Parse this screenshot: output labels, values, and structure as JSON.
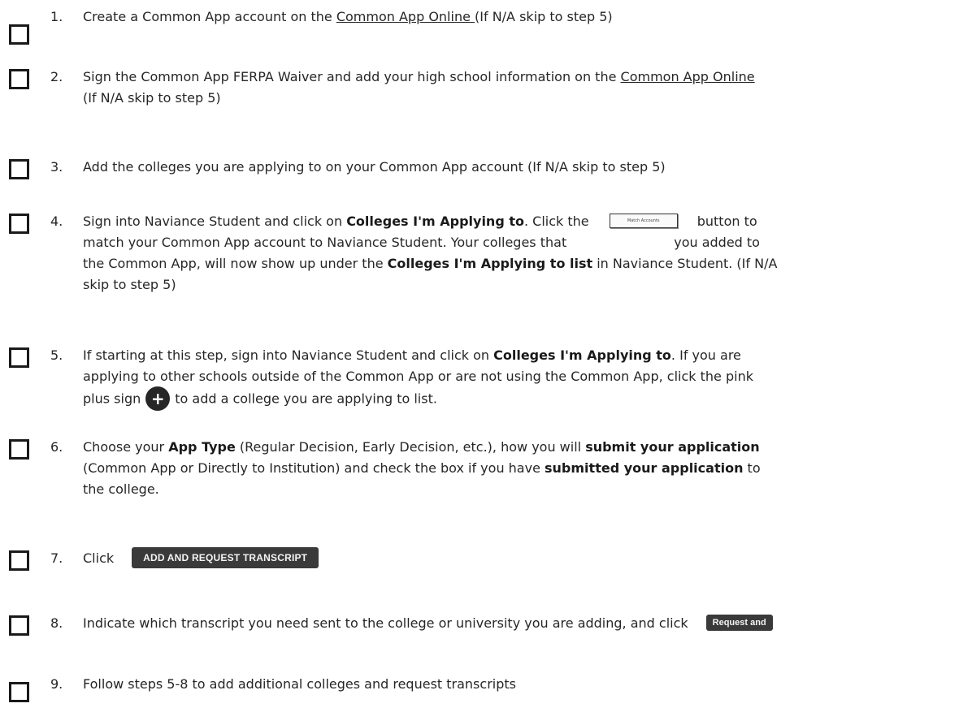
{
  "steps": [
    {
      "number": "1.",
      "lines": [
        [
          "Create a Common App account on the ",
          "Common App Online ",
          "(If N/A skip to step 5)"
        ]
      ]
    },
    {
      "number": "2.",
      "line1_a": "Sign the Common App FERPA Waiver and add your high school information on the ",
      "line1_link": "Common App Online",
      "line2": "(If N/A skip to step 5)"
    },
    {
      "number": "3.",
      "text": "Add the colleges you are applying to on your Common App account (If N/A skip to step 5)"
    },
    {
      "number": "4.",
      "l1_a": "Sign into Naviance Student and click on ",
      "l1_b": "Colleges I'm Applying to",
      "l1_c": ". Click the",
      "button_label": "Match Accounts",
      "l1_d": "button to",
      "l2_a": "match your Common App account to Naviance Student.  Your colleges that",
      "l2_b": "you added to",
      "l3_a": "the Common App, will now show up under the ",
      "l3_b": "Colleges I'm Applying to list",
      "l3_c": " in Naviance Student. (If N/A",
      "l4": "skip to step 5)"
    },
    {
      "number": "5.",
      "l1_a": "If starting at this step, sign into Naviance Student and click on ",
      "l1_b": "Colleges I'm Applying to",
      "l1_c": ".  If you are",
      "l2": "applying to other schools outside of the Common App or are not using the Common App, click the pink",
      "l3_a": "plus sign",
      "l3_b": "to add a college you are applying to list."
    },
    {
      "number": "6.",
      "l1_a": "Choose your ",
      "l1_b": "App Type",
      "l1_c": " (Regular Decision, Early Decision, etc.), how you will ",
      "l1_d": "submit your application",
      "l2_a": "(Common App or Directly to Institution) and check the box if you have ",
      "l2_b": "submitted your application",
      "l2_c": " to",
      "l3": "the college."
    },
    {
      "number": "7.",
      "text": "Click",
      "button_label": "ADD AND REQUEST TRANSCRIPT"
    },
    {
      "number": "8.",
      "text": "Indicate which transcript you need sent to the college or university you are adding, and click",
      "button_label": "Request and"
    },
    {
      "number": "9.",
      "text": "Follow steps 5-8 to add additional colleges and request transcripts"
    }
  ]
}
